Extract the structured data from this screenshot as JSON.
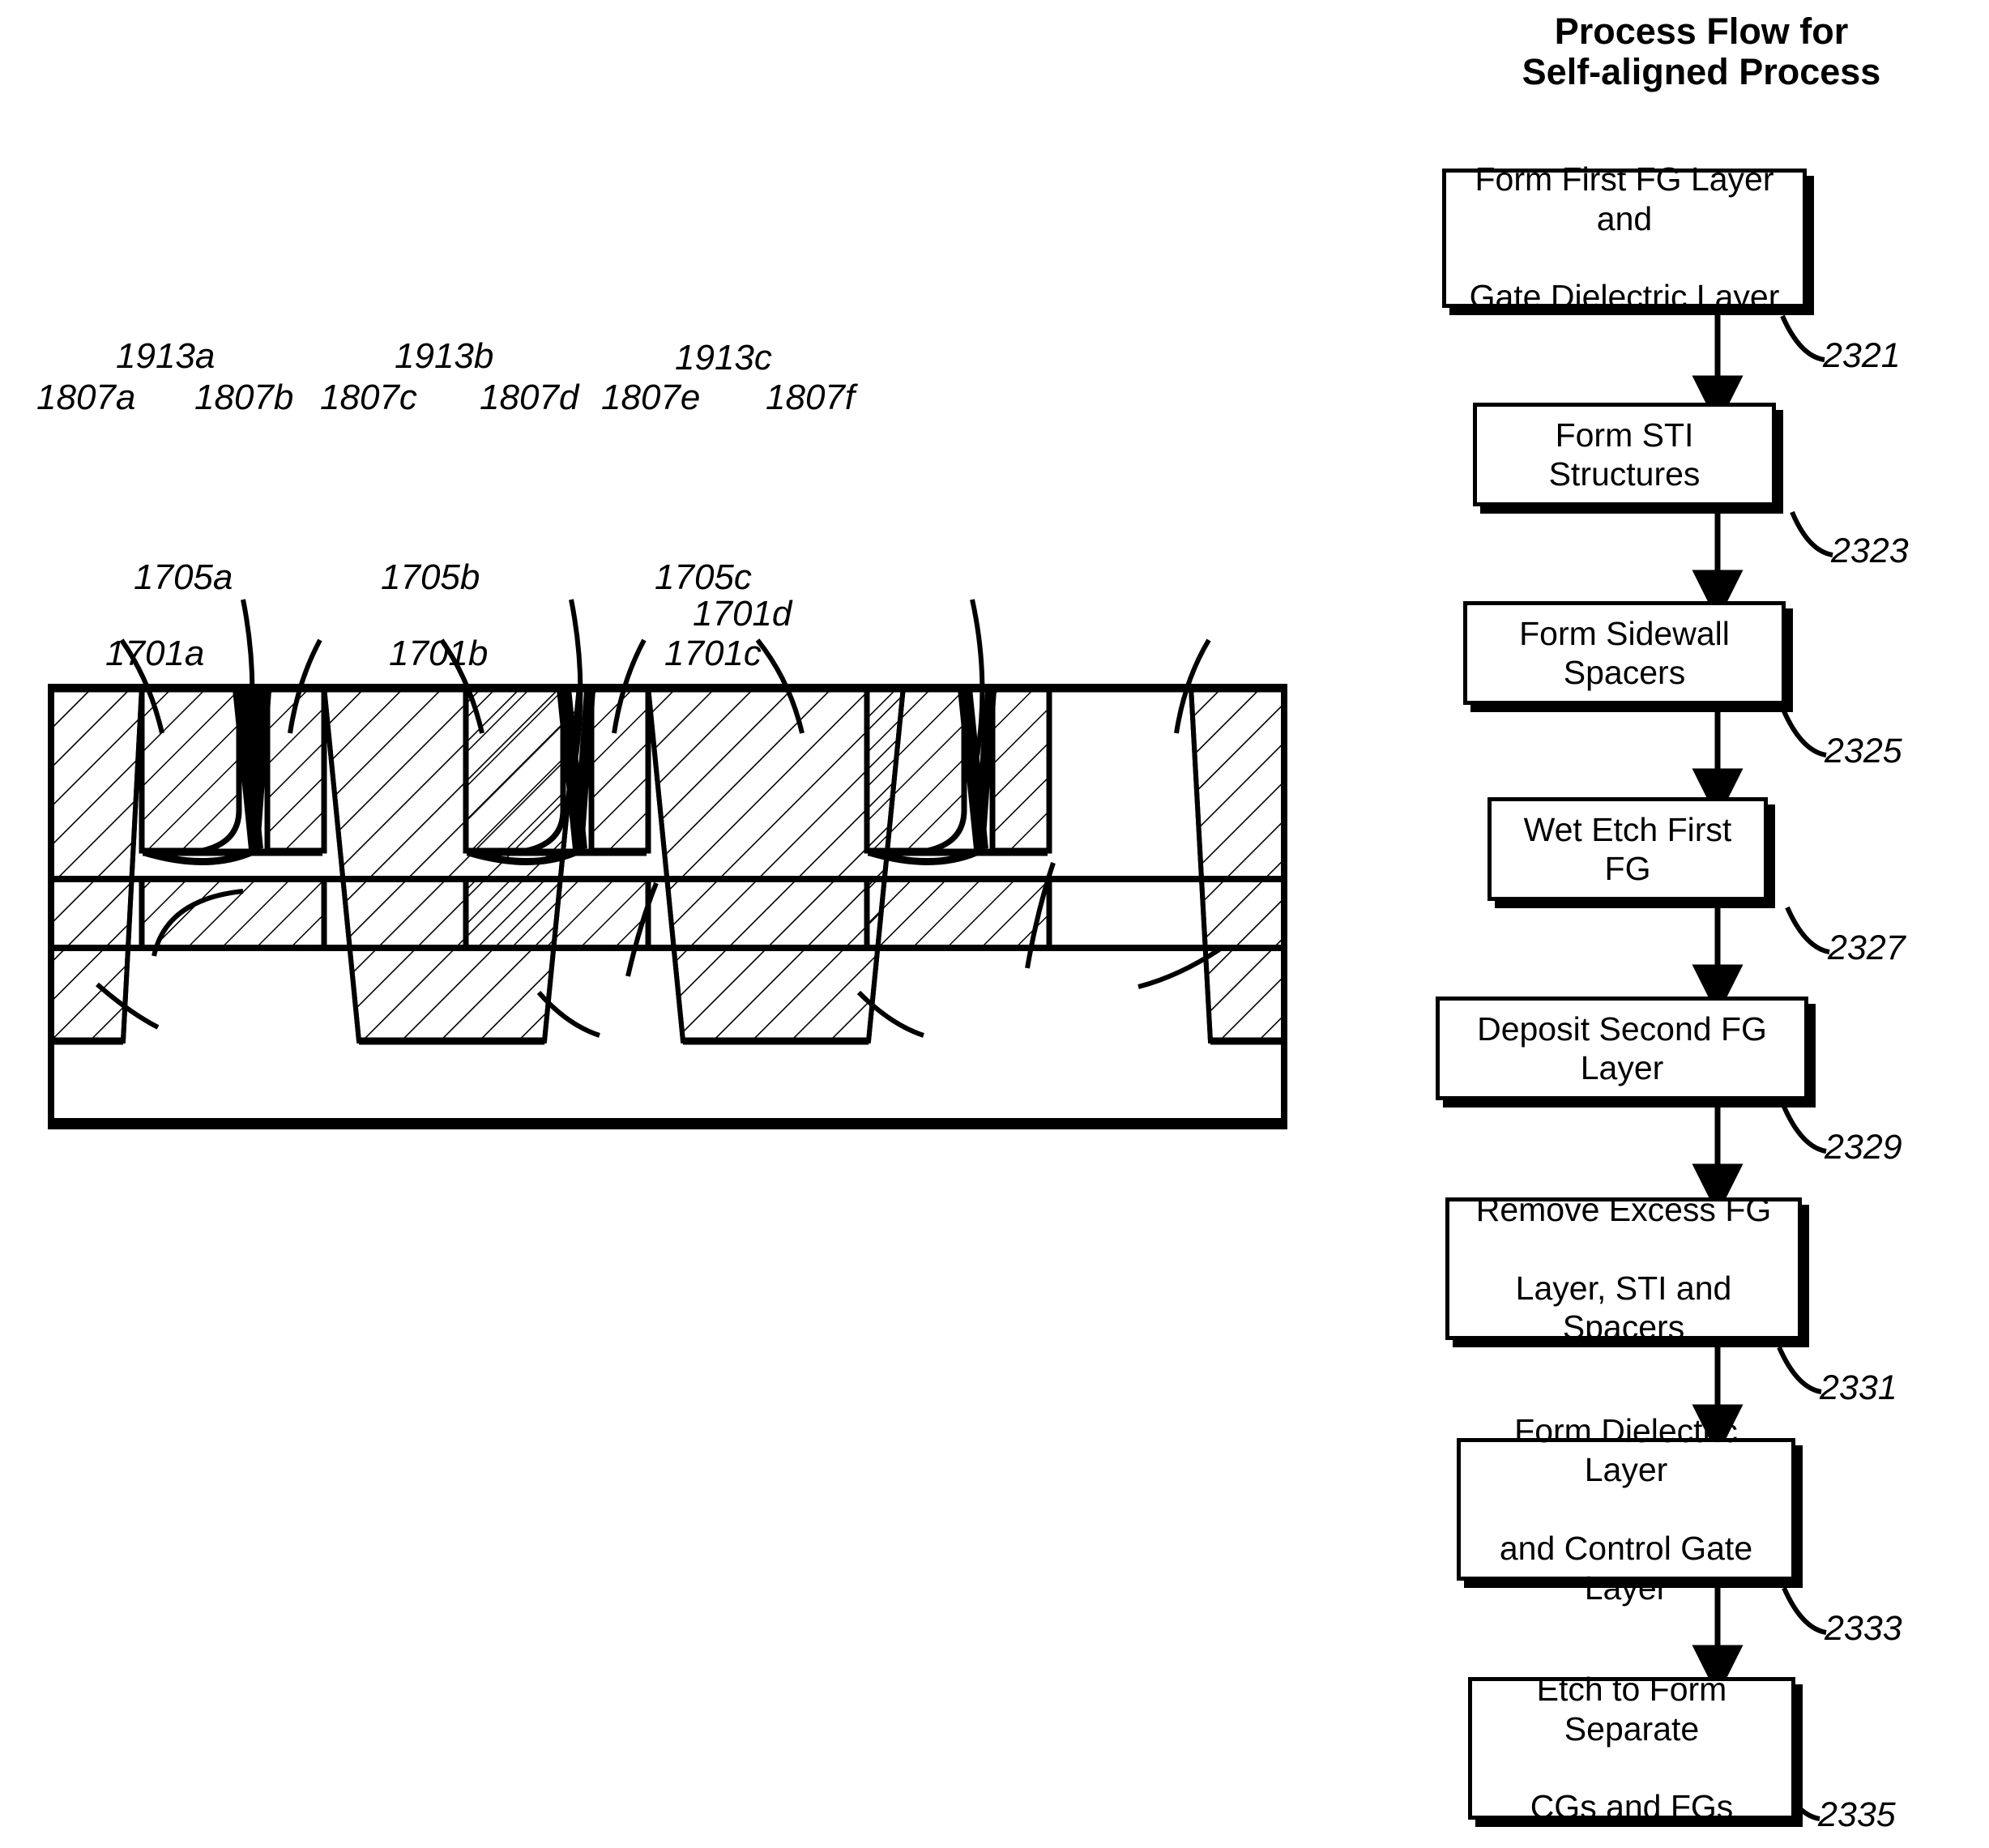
{
  "flowchart": {
    "title_line1": "Process Flow for",
    "title_line2": "Self-aligned Process",
    "steps": [
      {
        "label_line1": "Form First FG Layer and",
        "label_line2": "Gate Dielectric Layer",
        "ref": "2321"
      },
      {
        "label_line1": "Form STI Structures",
        "label_line2": "",
        "ref": "2323"
      },
      {
        "label_line1": "Form Sidewall Spacers",
        "label_line2": "",
        "ref": "2325"
      },
      {
        "label_line1": "Wet Etch First FG",
        "label_line2": "",
        "ref": "2327"
      },
      {
        "label_line1": "Deposit Second FG Layer",
        "label_line2": "",
        "ref": "2329"
      },
      {
        "label_line1": "Remove Excess FG",
        "label_line2": "Layer, STI and Spacers",
        "ref": "2331"
      },
      {
        "label_line1": "Form Dielectric Layer",
        "label_line2": "and Control Gate Layer",
        "ref": "2333"
      },
      {
        "label_line1": "Etch to Form Separate",
        "label_line2": "CGs and FGs",
        "ref": "2335"
      }
    ]
  },
  "cross_section": {
    "labels": {
      "sti_1": "1807a",
      "sti_2": "1807b",
      "sti_3": "1807c",
      "sti_4": "1807d",
      "sti_5": "1807e",
      "sti_6": "1807f",
      "fg2_1": "1913a",
      "fg2_2": "1913b",
      "fg2_3": "1913c",
      "fg1_1": "1705a",
      "fg1_2": "1705b",
      "fg1_3": "1705c",
      "trench_1": "1701a",
      "trench_2": "1701b",
      "trench_3": "1701c",
      "trench_4": "1701d"
    }
  },
  "colors": {
    "ink": "#000000",
    "paper": "#ffffff"
  }
}
